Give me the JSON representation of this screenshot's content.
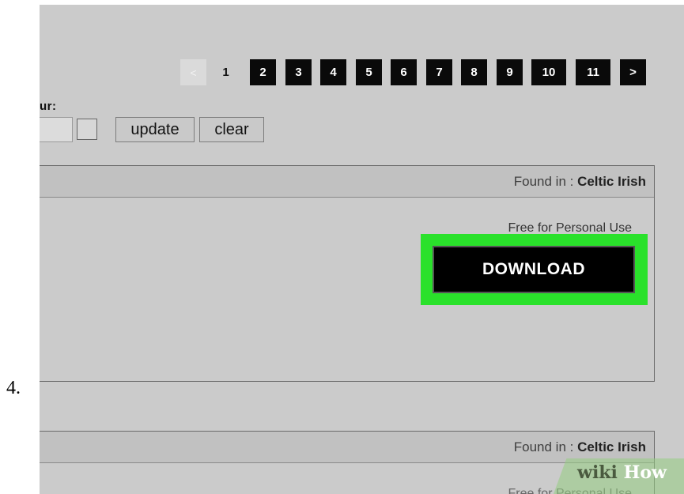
{
  "step": {
    "number": "4."
  },
  "pagination": {
    "prev": "<",
    "pages": [
      "1",
      "2",
      "3",
      "4",
      "5",
      "6",
      "7",
      "8",
      "9",
      "10",
      "11"
    ],
    "current": "1",
    "next": ">"
  },
  "filter": {
    "label": "ur:",
    "color_value": "",
    "update_label": "update",
    "clear_label": "clear"
  },
  "results": [
    {
      "found_prefix": "Found in : ",
      "found_category": "Celtic Irish",
      "license": "Free for Personal Use",
      "download_label": "DOWNLOAD"
    },
    {
      "found_prefix": "Found in : ",
      "found_category": "Celtic Irish",
      "license": "Free for Personal Use"
    }
  ],
  "highlight_color": "#2ae12b",
  "watermark": {
    "brand_a": "wiki",
    "brand_b": "How"
  }
}
